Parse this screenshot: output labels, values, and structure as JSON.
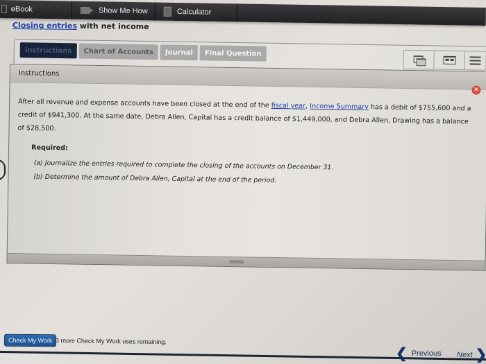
{
  "topbar": {
    "items": [
      {
        "label": "eBook",
        "icon": "book-icon"
      },
      {
        "label": "Show Me How",
        "icon": "video-icon"
      },
      {
        "label": "Calculator",
        "icon": "calculator-icon"
      }
    ]
  },
  "header": {
    "title_link": "Closing entries",
    "title_rest": " with net income"
  },
  "tabs": [
    {
      "label": "Instructions",
      "active": true
    },
    {
      "label": "Chart of Accounts",
      "active": false
    },
    {
      "label": "Journal",
      "active": false
    },
    {
      "label": "Final Question",
      "active": false
    }
  ],
  "view_buttons": [
    "cascade-view-icon",
    "split-view-icon",
    "stacked-view-icon"
  ],
  "panel": {
    "header": "Instructions",
    "close_icon": "×",
    "para_1": "After all revenue and expense accounts have been closed at the end of the ",
    "link_fiscal_year": "fiscal year",
    "para_2": ", ",
    "link_income_summary": "Income Summary",
    "para_3": " has a debit of $755,600 and a credit of $941,300. At the same date, Debra Allen, Capital has a credit balance of $1,449,000, and Debra Allen, Drawing has a balance of $28,500.",
    "required_label": "Required:",
    "required_a": "(a) Journalize the entries required to complete the closing of the accounts on December 31.",
    "required_b": "(b) Determine the amount of Debra Allen, Capital at the end of the period."
  },
  "footer": {
    "check_button": "Check My Work",
    "remaining_text": "3 more Check My Work uses remaining.",
    "previous_label": "Previous",
    "next_label": "Next",
    "prev_chevron": "❮",
    "next_chevron": "❯"
  }
}
